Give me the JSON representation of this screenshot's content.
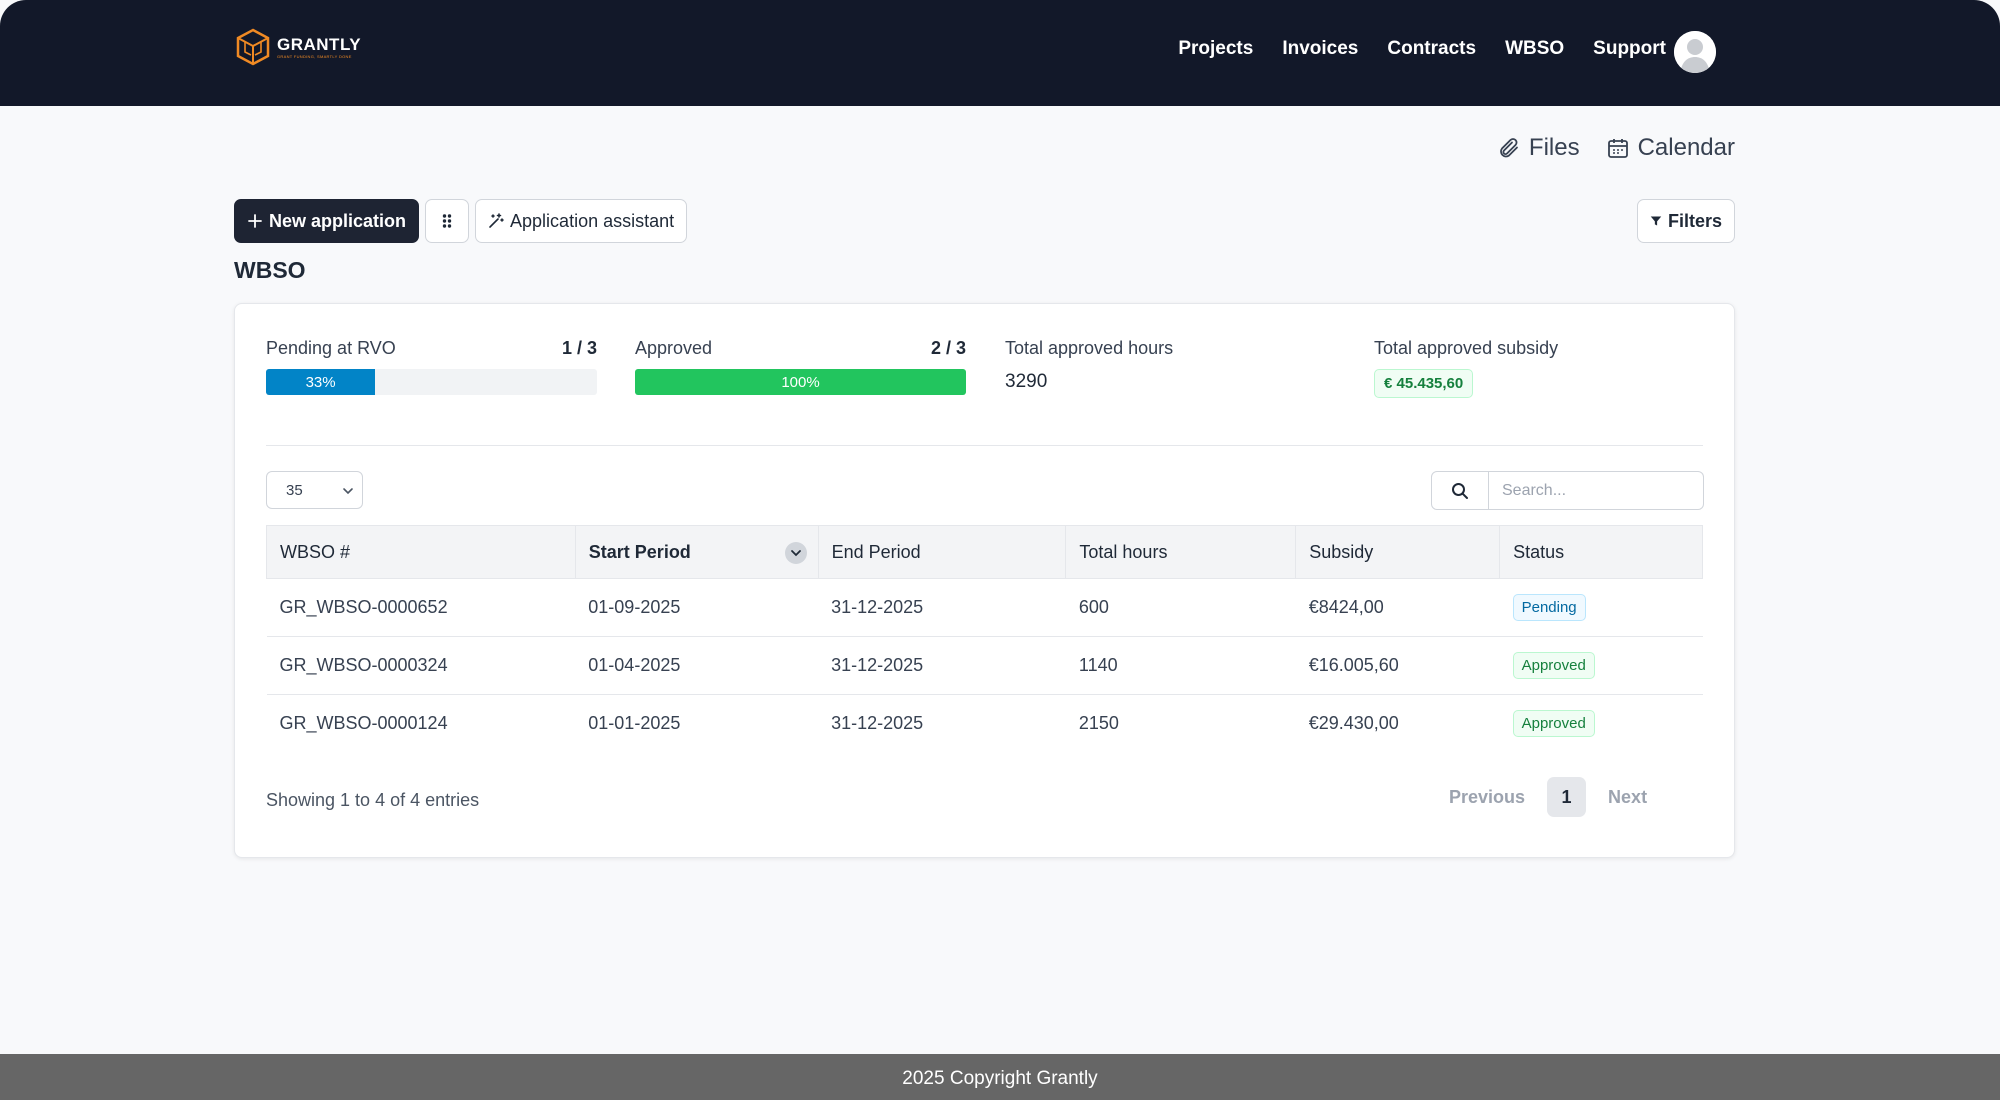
{
  "nav": {
    "brand": "GRANTLY",
    "tagline": "GRANT FUNDING, SMARTLY DONE",
    "links": [
      "Projects",
      "Invoices",
      "Contracts",
      "WBSO",
      "Support"
    ]
  },
  "top_links": {
    "files": "Files",
    "calendar": "Calendar"
  },
  "toolbar": {
    "new_application": "New application",
    "assistant": "Application assistant",
    "filters": "Filters"
  },
  "page_title": "WBSO",
  "stats": {
    "pending": {
      "label": "Pending at RVO",
      "fraction": "1 / 3",
      "percent_label": "33%",
      "percent": 33,
      "color": "#0284c7"
    },
    "approved": {
      "label": "Approved",
      "fraction": "2 / 3",
      "percent_label": "100%",
      "percent": 100,
      "color": "#22c55e"
    },
    "hours": {
      "label": "Total approved hours",
      "value": "3290"
    },
    "subsidy": {
      "label": "Total approved subsidy",
      "value": "€ 45.435,60"
    }
  },
  "table": {
    "page_size": "35",
    "search_placeholder": "Search...",
    "columns": [
      "WBSO #",
      "Start Period",
      "End Period",
      "Total hours",
      "Subsidy",
      "Status"
    ],
    "rows": [
      {
        "id": "GR_WBSO-0000652",
        "start": "01-09-2025",
        "end": "31-12-2025",
        "hours": "600",
        "subsidy": "€8424,00",
        "status": "Pending"
      },
      {
        "id": "GR_WBSO-0000324",
        "start": "01-04-2025",
        "end": "31-12-2025",
        "hours": "1140",
        "subsidy": "€16.005,60",
        "status": "Approved"
      },
      {
        "id": "GR_WBSO-0000124",
        "start": "01-01-2025",
        "end": "31-12-2025",
        "hours": "2150",
        "subsidy": "€29.430,00",
        "status": "Approved"
      }
    ],
    "entries_info": "Showing 1 to 4 of 4 entries",
    "pagination": {
      "previous": "Previous",
      "current": "1",
      "next": "Next"
    }
  },
  "footer": "2025 Copyright Grantly",
  "icons": {
    "logo": "grantly-cube-logo",
    "avatar": "user-avatar-icon",
    "files": "paperclip-icon",
    "calendar": "calendar-icon",
    "new_application": "plus-icon",
    "grid": "grip-dots-icon",
    "assistant": "magic-wand-icon",
    "filters": "funnel-icon",
    "search": "search-icon",
    "sort": "chevron-down-icon"
  }
}
